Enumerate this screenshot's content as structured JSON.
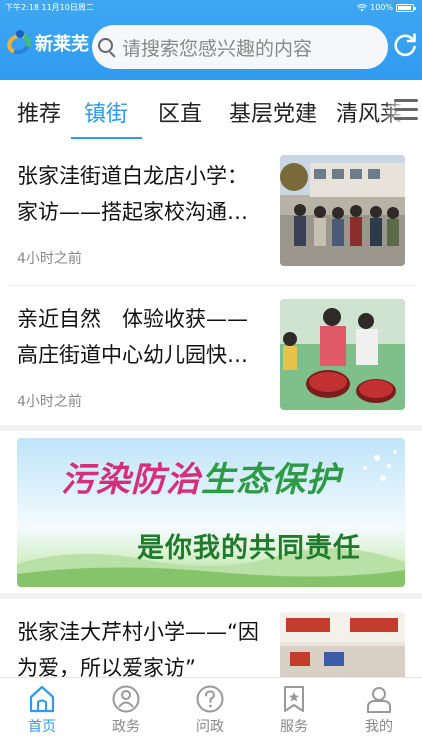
{
  "status_bar": {
    "time": "下午2:18  11月10日周二",
    "battery": "100%"
  },
  "header": {
    "logo_text": "新莱芜",
    "search_placeholder": "请搜索您感兴趣的内容",
    "accent_color": "#2f9bf0"
  },
  "tabs": [
    {
      "label": "推荐",
      "active": false
    },
    {
      "label": "镇街",
      "active": true
    },
    {
      "label": "区直",
      "active": false
    },
    {
      "label": "基层党建",
      "active": false
    },
    {
      "label": "清风莱",
      "active": false
    }
  ],
  "news": [
    {
      "title": "张家洼街道白龙店小学：家访——搭起家校沟通的桥梁",
      "time": "4小时之前",
      "thumb": "school-visit-photo"
    },
    {
      "title": "亲近自然　体验收获——　高庄街道中心幼儿园快乐采…",
      "time": "4小时之前",
      "thumb": "kindergarten-harvest-photo"
    },
    {
      "title": "张家洼大芹村小学——“因为爱，所以爱家访”",
      "time": "",
      "thumb": "classroom-photo"
    }
  ],
  "banner": {
    "line1_part1": "污染防治",
    "line1_part2": "生态保护",
    "line2": "是你我的共同责任"
  },
  "bottom_nav": [
    {
      "label": "首页",
      "icon": "home-icon",
      "active": true
    },
    {
      "label": "政务",
      "icon": "government-icon",
      "active": false
    },
    {
      "label": "问政",
      "icon": "question-icon",
      "active": false
    },
    {
      "label": "服务",
      "icon": "service-bookmark-icon",
      "active": false
    },
    {
      "label": "我的",
      "icon": "user-icon",
      "active": false
    }
  ]
}
